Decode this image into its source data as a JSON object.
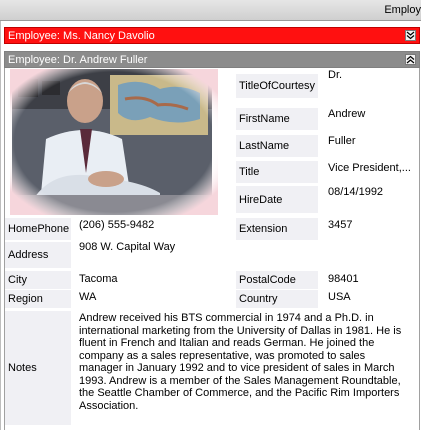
{
  "window": {
    "title": "Employ"
  },
  "collapsed_record": {
    "header": "Employee: Ms. Nancy Davolio"
  },
  "record": {
    "header": "Employee: Dr. Andrew Fuller",
    "photo_alt": "Photo",
    "fields": {
      "title_of_courtesy": {
        "label": "TitleOfCourtesy",
        "value": "Dr."
      },
      "first_name": {
        "label": "FirstName",
        "value": "Andrew"
      },
      "last_name": {
        "label": "LastName",
        "value": "Fuller"
      },
      "title": {
        "label": "Title",
        "value": "Vice President,..."
      },
      "hire_date": {
        "label": "HireDate",
        "value": "08/14/1992"
      },
      "home_phone": {
        "label": "HomePhone",
        "value": "(206) 555-9482"
      },
      "extension": {
        "label": "Extension",
        "value": "3457"
      },
      "address": {
        "label": "Address",
        "value": "908 W. Capital Way"
      },
      "city": {
        "label": "City",
        "value": "Tacoma"
      },
      "postal_code": {
        "label": "PostalCode",
        "value": "98401"
      },
      "region": {
        "label": "Region",
        "value": "WA"
      },
      "country": {
        "label": "Country",
        "value": "USA"
      },
      "notes": {
        "label": "Notes",
        "value": "Andrew received his BTS commercial in 1974 and a Ph.D. in international marketing from the University of Dallas in 1981.  He is fluent in French and Italian and reads German.  He joined the company as a sales representative, was promoted to sales manager in January 1992 and to vice president of sales in March 1993.  Andrew is a member of the Sales Management Roundtable, the Seattle Chamber of Commerce, and the Pacific Rim Importers Association."
      }
    }
  },
  "icons": {
    "expand": "chevron-double-down-icon",
    "collapse": "chevron-double-up-icon"
  },
  "colors": {
    "collapsed_header": "#ff1010",
    "expanded_header": "#8c8c8c",
    "label_bg": "#f0f0f4"
  }
}
